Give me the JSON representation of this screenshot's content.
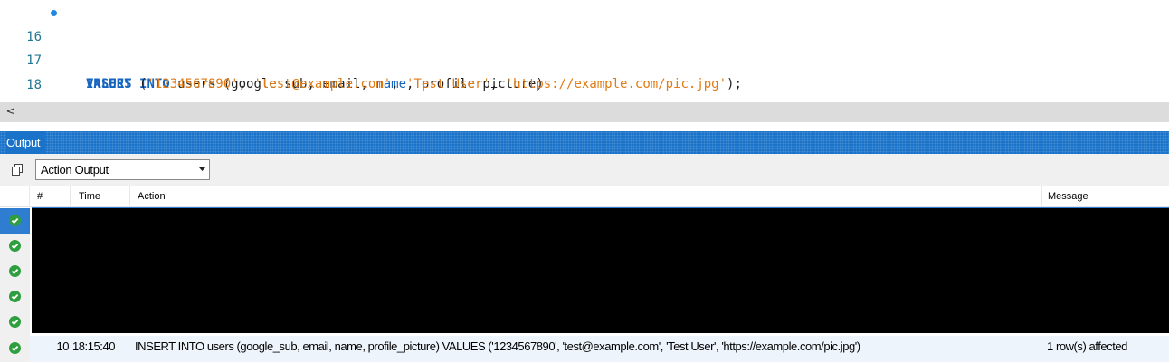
{
  "editor": {
    "lines": [
      {
        "number": "16",
        "marker": true,
        "tokens": [
          {
            "text": "INSERT",
            "type": "kw"
          },
          {
            "text": " ",
            "type": "plain"
          },
          {
            "text": "INTO",
            "type": "kw"
          },
          {
            "text": " users (google_sub, email, ",
            "type": "plain"
          },
          {
            "text": "name",
            "type": "kw-plain"
          },
          {
            "text": ", profile_picture)",
            "type": "plain"
          }
        ]
      },
      {
        "number": "17",
        "marker": false,
        "tokens": [
          {
            "text": "VALUES",
            "type": "kw"
          },
          {
            "text": " (",
            "type": "plain"
          },
          {
            "text": "'1234567890'",
            "type": "str"
          },
          {
            "text": ", ",
            "type": "plain"
          },
          {
            "text": "'test@example.com'",
            "type": "str"
          },
          {
            "text": ", ",
            "type": "plain"
          },
          {
            "text": "'Test User'",
            "type": "str"
          },
          {
            "text": ", ",
            "type": "plain"
          },
          {
            "text": "'https://example.com/pic.jpg'",
            "type": "str"
          },
          {
            "text": ");",
            "type": "plain"
          }
        ]
      },
      {
        "number": "18",
        "marker": false,
        "tokens": []
      }
    ]
  },
  "scrollbar": {
    "left_arrow": "<"
  },
  "output": {
    "title": "Output",
    "toolbar": {
      "copy_icon": "copy-icon",
      "select_value": "Action Output"
    },
    "columns": {
      "status": "",
      "num": "#",
      "time": "Time",
      "action": "Action",
      "message": "Message"
    },
    "rows": [
      {
        "status": "ok",
        "redacted": true
      },
      {
        "status": "ok",
        "redacted": true
      },
      {
        "status": "ok",
        "redacted": true
      },
      {
        "status": "ok",
        "redacted": true
      },
      {
        "status": "ok",
        "redacted": true
      },
      {
        "status": "ok",
        "redacted": false,
        "num": "10",
        "time": "18:15:40",
        "action": "INSERT INTO users (google_sub, email, name, profile_picture) VALUES ('1234567890', 'test@example.com', 'Test User', 'https://example.com/pic.jpg')",
        "message": "1 row(s) affected"
      }
    ]
  },
  "colors": {
    "keyword": "#1565c0",
    "string": "#e07b16",
    "accent": "#1a73c9",
    "success": "#2e9e3e"
  }
}
